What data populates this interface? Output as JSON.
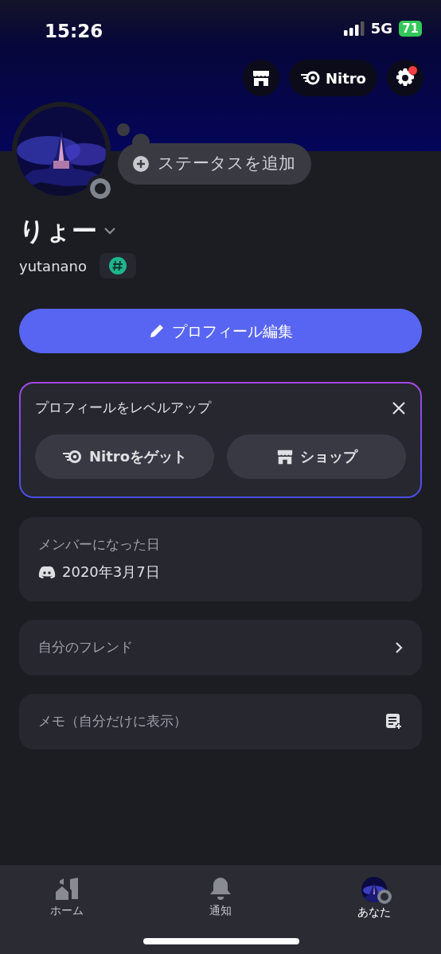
{
  "status_bar": {
    "time": "15:26",
    "network": "5G",
    "battery": "71"
  },
  "top_actions": {
    "nitro_label": "Nitro",
    "settings_alert": true
  },
  "profile": {
    "add_status": "ステータスを追加",
    "display_name": "りょー",
    "username": "yutanano"
  },
  "edit_button": "プロフィール編集",
  "upgrade_card": {
    "title": "プロフィールをレベルアップ",
    "buttons": [
      {
        "kind": "nitro",
        "label": "Nitroをゲット"
      },
      {
        "kind": "shop",
        "label": "ショップ"
      }
    ]
  },
  "member_since": {
    "label": "メンバーになった日",
    "date": "2020年3月7日"
  },
  "rows": [
    {
      "kind": "link",
      "label": "自分のフレンド"
    },
    {
      "kind": "note",
      "label": "メモ（自分だけに表示）"
    }
  ],
  "tabs": [
    {
      "kind": "home",
      "label": "ホーム",
      "selected": false
    },
    {
      "kind": "bell",
      "label": "通知",
      "selected": false
    },
    {
      "kind": "avatar",
      "label": "あなた",
      "selected": true
    }
  ]
}
